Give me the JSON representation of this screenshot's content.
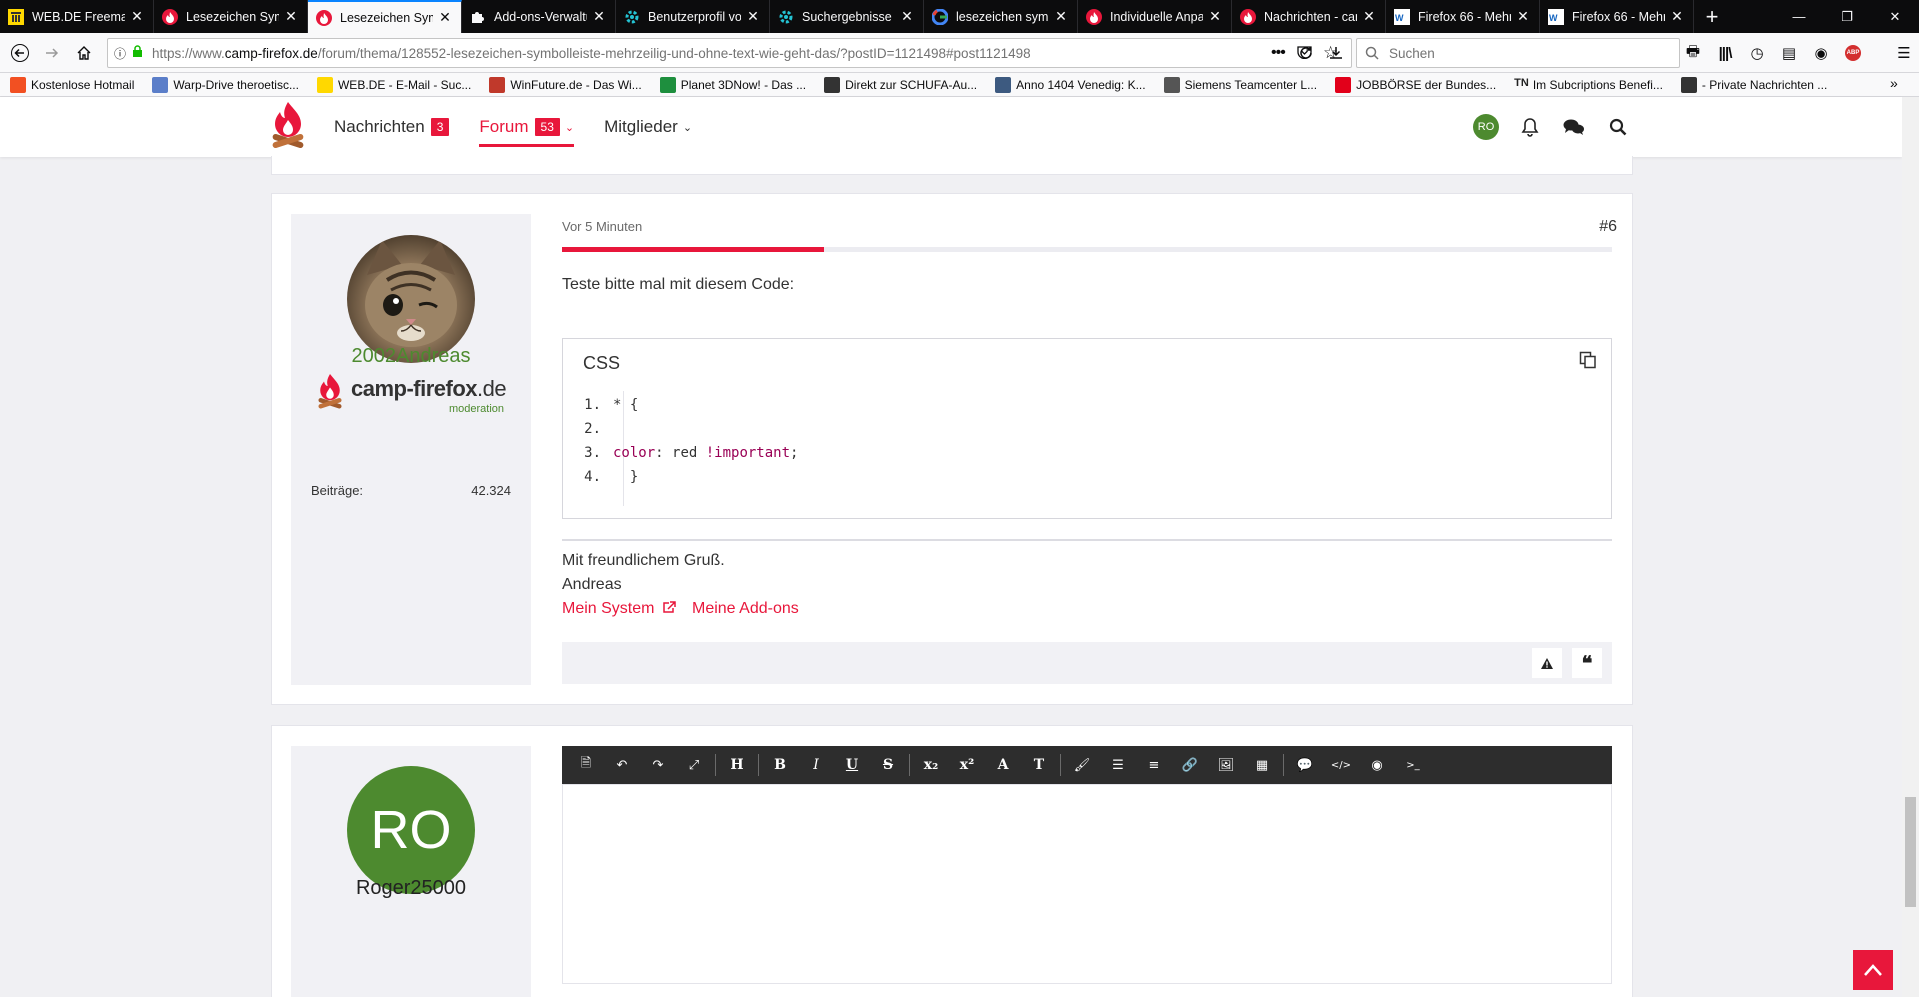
{
  "browser": {
    "tabs": [
      {
        "label": "WEB.DE Freemail",
        "icon": "webde-icon",
        "active": false
      },
      {
        "label": "Lesezeichen Symb",
        "icon": "campfirefox-icon",
        "active": false
      },
      {
        "label": "Lesezeichen Symb",
        "icon": "campfirefox-icon",
        "active": true
      },
      {
        "label": "Add-ons-Verwaltu",
        "icon": "puzzle-icon",
        "active": false
      },
      {
        "label": "Benutzerprofil vo",
        "icon": "gear-icon",
        "active": false
      },
      {
        "label": "Suchergebnisse fü",
        "icon": "gear-icon",
        "active": false
      },
      {
        "label": "lesezeichen symb",
        "icon": "google-icon",
        "active": false
      },
      {
        "label": "Individuelle Anpa",
        "icon": "campfirefox-icon",
        "active": false
      },
      {
        "label": "Nachrichten - cam",
        "icon": "campfirefox-icon",
        "active": false
      },
      {
        "label": "Firefox 66 - Mehr",
        "icon": "wp-icon",
        "active": false
      },
      {
        "label": "Firefox 66 - Mehr",
        "icon": "wp-icon",
        "active": false
      }
    ],
    "url_prefix": "https://www.",
    "url_domain": "camp-firefox.de",
    "url_path": "/forum/thema/128552-lesezeichen-symbolleiste-mehrzeilig-und-ohne-text-wie-geht-das/?postID=1121498#post1121498",
    "search_placeholder": "Suchen",
    "bookmarks": [
      {
        "label": "Kostenlose Hotmail",
        "color": "#f25022"
      },
      {
        "label": "Warp-Drive theroetisc...",
        "color": "#5b7ec9"
      },
      {
        "label": "WEB.DE - E-Mail - Suc...",
        "color": "#ffd800"
      },
      {
        "label": "WinFuture.de - Das Wi...",
        "color": "#c0392b"
      },
      {
        "label": "Planet 3DNow! - Das ...",
        "color": "#1e8f3e"
      },
      {
        "label": "Direkt zur SCHUFA-Au...",
        "color": "#333333"
      },
      {
        "label": "Anno 1404 Venedig: K...",
        "color": "#3d5a80"
      },
      {
        "label": "Siemens Teamcenter L...",
        "color": "#555555"
      },
      {
        "label": "JOBBÖRSE der Bundes...",
        "color": "#e2001a"
      },
      {
        "label": "Im Subcriptions Benefi...",
        "color": "#222222",
        "prefix": "TN"
      },
      {
        "label": "- Private Nachrichten ...",
        "color": "#333333"
      }
    ]
  },
  "site": {
    "nav": [
      {
        "label": "Nachrichten",
        "badge": "3"
      },
      {
        "label": "Forum",
        "badge": "53"
      },
      {
        "label": "Mitglieder",
        "badge": ""
      }
    ],
    "user_initials": "RO",
    "accent": "#e8173b"
  },
  "post": {
    "time": "Vor 5 Minuten",
    "number": "#6",
    "intro": "Teste bitte mal mit diesem Code:",
    "code_title": "CSS",
    "code_lines": [
      {
        "n": "1.",
        "text": "* {"
      },
      {
        "n": "2.",
        "text": ""
      },
      {
        "n": "3.",
        "prop": "color",
        "value": ": red ",
        "important": "!important",
        "end": ";"
      },
      {
        "n": "4.",
        "text": "  }"
      }
    ],
    "signature_greeting": "Mit freundlichem Gruß.",
    "signature_name": "Andreas",
    "links": [
      "Mein System",
      "Meine Add-ons"
    ],
    "author": {
      "name": "2002Andreas",
      "logo_text_main": "camp-firefox",
      "logo_text_tld": ".de",
      "logo_sub": "moderation",
      "stat_label": "Beiträge:",
      "stat_value": "42.324"
    }
  },
  "reply": {
    "avatar_initials": "RO",
    "avatar_color": "#4d8a2f",
    "username": "Roger25000",
    "toolbar": [
      "file-icon",
      "undo-icon",
      "redo-icon",
      "fullscreen-icon",
      "H",
      "B",
      "I",
      "U",
      "S",
      "x₂",
      "x²",
      "A",
      "T",
      "brush-icon",
      "list-icon",
      "align-icon",
      "link-icon",
      "image-icon",
      "table-icon",
      "quote-icon",
      "code-icon",
      "spoiler-icon",
      "terminal-icon"
    ]
  }
}
